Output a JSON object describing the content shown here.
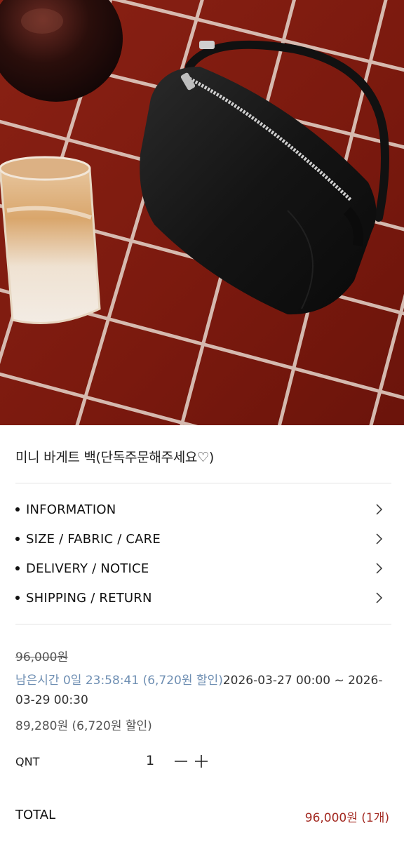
{
  "product": {
    "image_alt": "black leather mini baguette bag on red tiles",
    "title": "미니 바게트 백(단독주문해주세요♡)"
  },
  "accordion": {
    "items": [
      {
        "label": "INFORMATION"
      },
      {
        "label": "SIZE / FABRIC / CARE"
      },
      {
        "label": "DELIVERY / NOTICE"
      },
      {
        "label": "SHIPPING / RETURN"
      }
    ]
  },
  "pricing": {
    "original_price": "96,000원",
    "promo_timer": "남은시간 0일 23:58:41 (6,720원 할인)",
    "promo_period": "2026-03-27 00:00 ~ 2026-03-29 00:30",
    "sale_price": "89,280원 (6,720원 할인)"
  },
  "quantity": {
    "label": "QNT",
    "value": "1"
  },
  "total": {
    "label": "TOTAL",
    "value": "96,000원 (1개)"
  },
  "colors": {
    "accent_total": "#a32a22",
    "timer_text": "#6f8fb3",
    "tile_red": "#7e1a10"
  }
}
